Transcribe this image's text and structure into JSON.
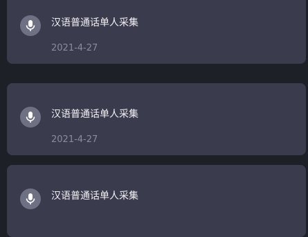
{
  "records": [
    {
      "icon": "microphone-icon",
      "title": "汉语普通话单人采集",
      "date": "2021-4-27"
    },
    {
      "icon": "microphone-icon",
      "title": "汉语普通话单人采集",
      "date": "2021-4-27"
    },
    {
      "icon": "microphone-icon",
      "title": "汉语普通话单人采集",
      "date": ""
    }
  ],
  "colors": {
    "background": "#1e2028",
    "card": "#3a3c4e",
    "icon_circle": "#6e7183",
    "title_text": "#f1f1f4",
    "date_text": "#8a8c9c"
  }
}
